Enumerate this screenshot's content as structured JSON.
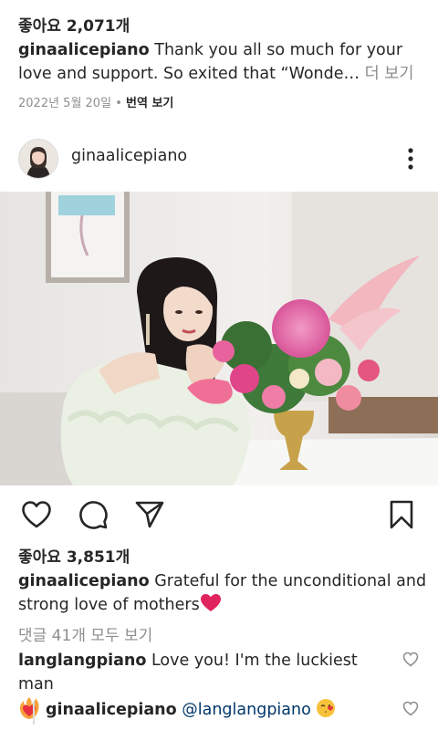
{
  "previous_post": {
    "likes": "좋아요 2,071개",
    "username": "ginaalicepiano",
    "caption": "Thank you all so much for your love and support. So exited that “Wonde…",
    "more_label": "더 보기",
    "date": "2022년 5월 20일",
    "separator": "•",
    "translate_label": "번역 보기"
  },
  "post": {
    "username": "ginaalicepiano",
    "likes": "좋아요 3,851개",
    "caption_username": "ginaalicepiano",
    "caption": "Grateful for the unconditional and strong love of mothers",
    "caption_emoji": "heart",
    "view_comments": "댓글 41개 모두 보기",
    "comments": [
      {
        "username": "langlangpiano",
        "text": "Love you! I'm the luckiest man",
        "emoji": "heart-on-fire"
      }
    ],
    "replies": [
      {
        "username": "ginaalicepiano",
        "mention": "@langlangpiano",
        "emoji": "face-blowing-a-kiss"
      }
    ]
  },
  "icons": {
    "header_more": "more-vertical-icon",
    "like": "heart-outline-icon",
    "comment": "comment-bubble-icon",
    "share": "paper-plane-icon",
    "save": "bookmark-icon",
    "comment_like": "small-heart-outline-icon"
  },
  "colors": {
    "text": "#262626",
    "secondary": "#8e8e8e",
    "link": "#00376b",
    "heart": "#e0245e"
  }
}
